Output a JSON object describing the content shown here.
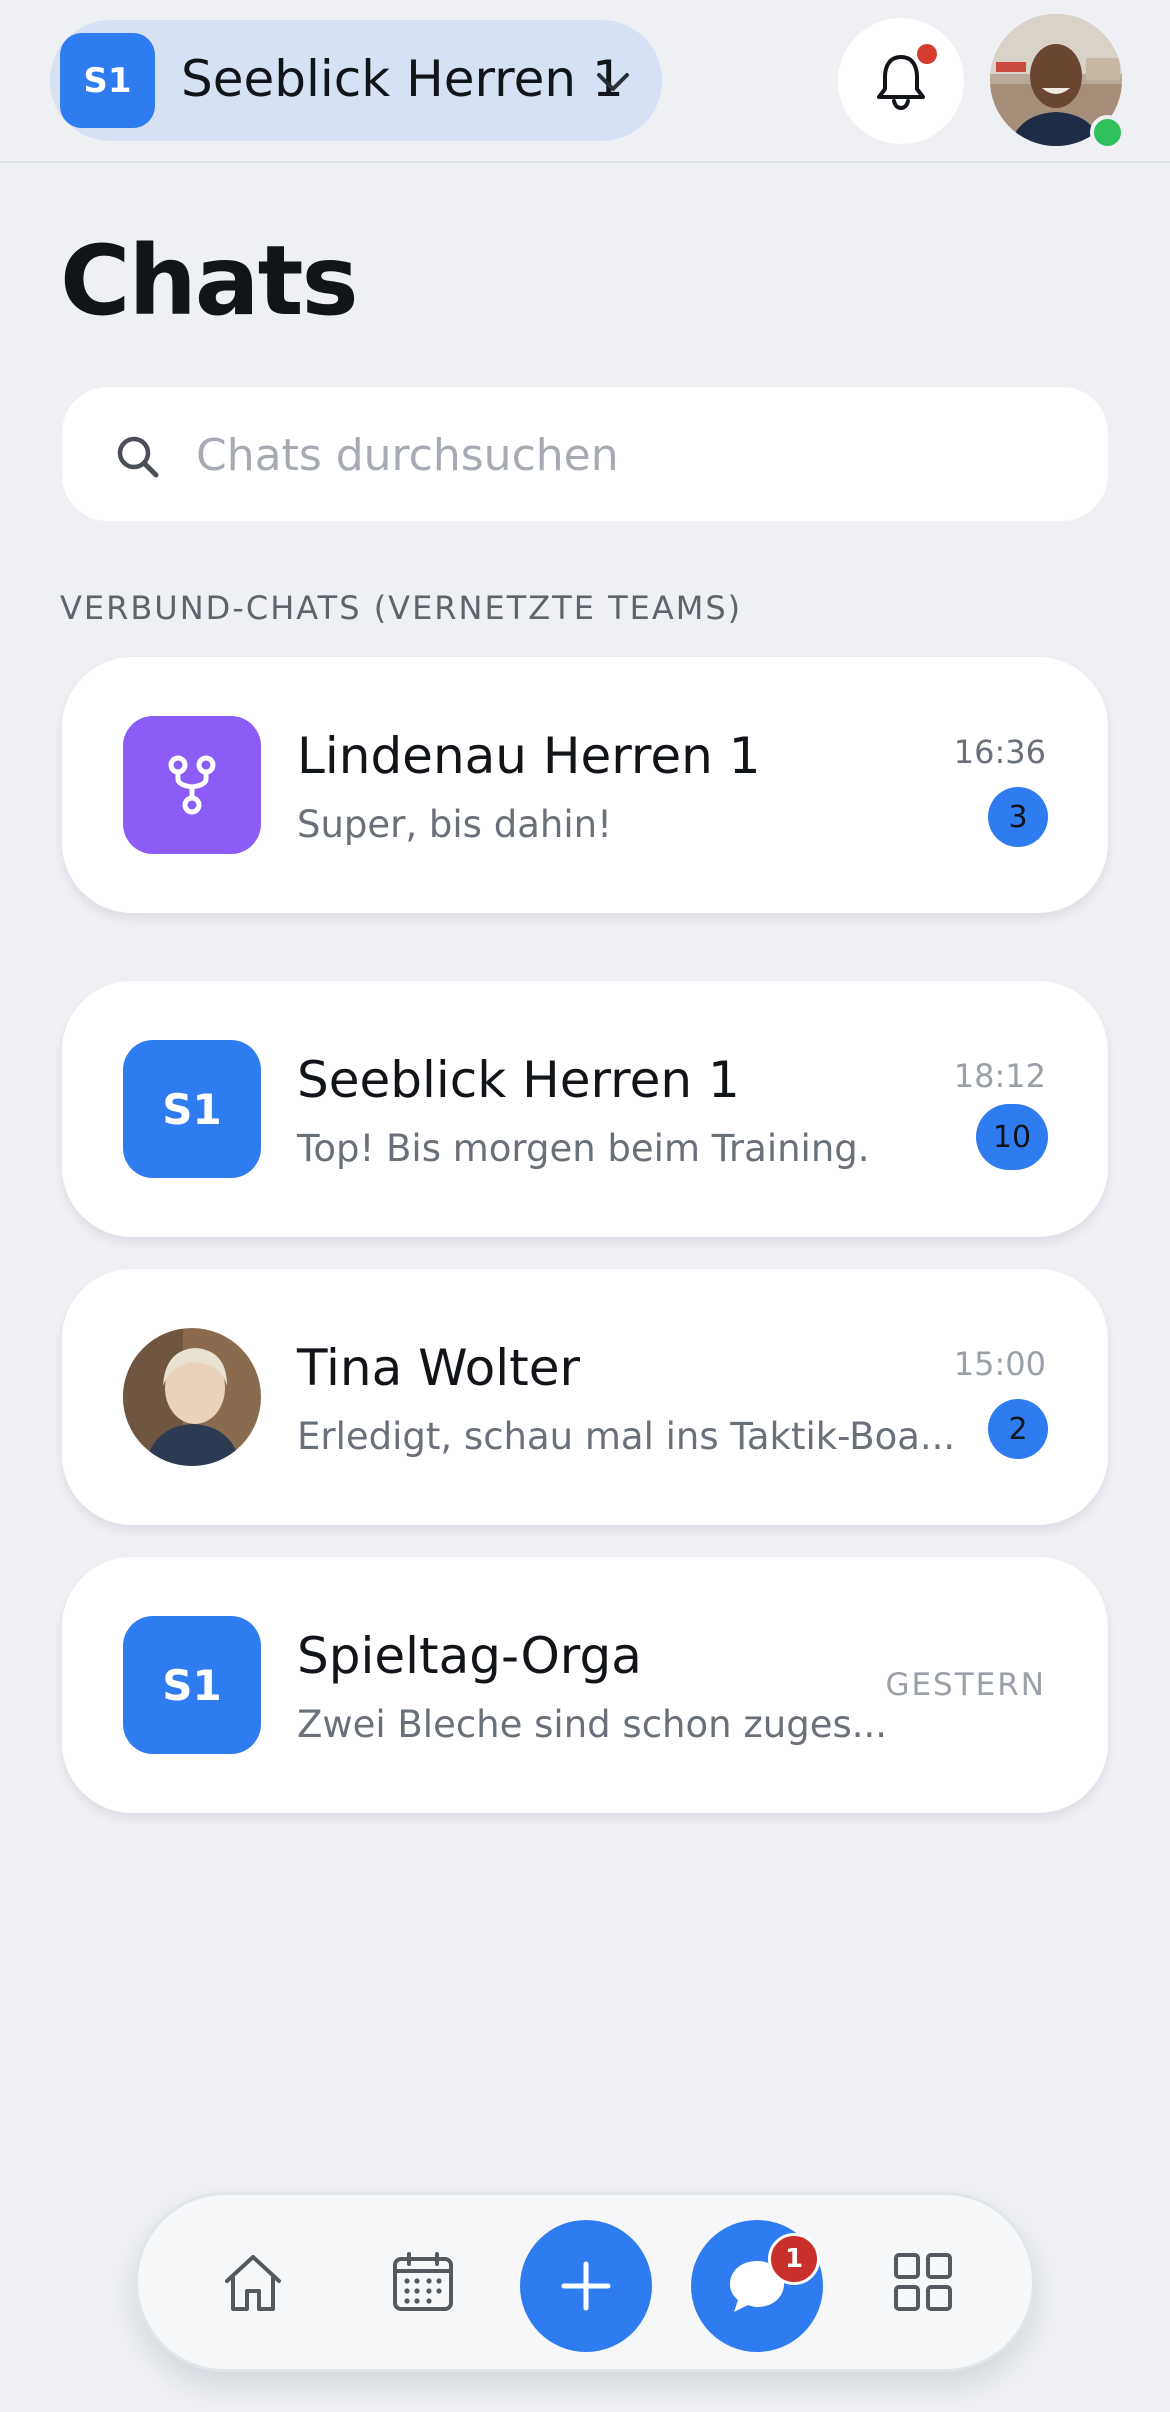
{
  "header": {
    "team_badge": "S1",
    "team_name": "Seeblick Herren 1",
    "notification_unread": true,
    "user_online": true
  },
  "page": {
    "title": "Chats"
  },
  "search": {
    "placeholder": "Chats durchsuchen",
    "value": ""
  },
  "section": {
    "label": "VERBUND-CHATS (VERNETZTE TEAMS)"
  },
  "chats": [
    {
      "name": "Lindenau Herren 1",
      "preview": "Super, bis dahin!",
      "time": "16:36",
      "unread": "3",
      "icon": "network-icon",
      "icon_color": "#8b5cf6"
    },
    {
      "name": "Seeblick Herren 1",
      "preview": "Top! Bis morgen beim Training.",
      "time": "18:12",
      "unread": "10",
      "badge": "S1",
      "icon_color": "#2f7cf0"
    },
    {
      "name": "Tina Wolter",
      "preview": "Erledigt, schau mal ins Taktik-Boa...",
      "time": "15:00",
      "unread": "2",
      "icon": "profile-photo"
    },
    {
      "name": "Spieltag-Orga",
      "preview": "Zwei Bleche sind schon zuges...",
      "time": "GESTERN",
      "badge": "S1",
      "icon_color": "#2f7cf0"
    }
  ],
  "tabbar": {
    "items": [
      {
        "icon": "home-icon"
      },
      {
        "icon": "calendar-icon"
      },
      {
        "icon": "plus-icon"
      },
      {
        "icon": "chat-icon",
        "badge": "1",
        "active": true
      },
      {
        "icon": "grid-icon"
      }
    ]
  },
  "colors": {
    "accent": "#2f7cf0",
    "background": "#eef0f4",
    "network_purple": "#8b5cf6",
    "notification_red": "#d43c2f",
    "online_green": "#2fbf5b"
  }
}
